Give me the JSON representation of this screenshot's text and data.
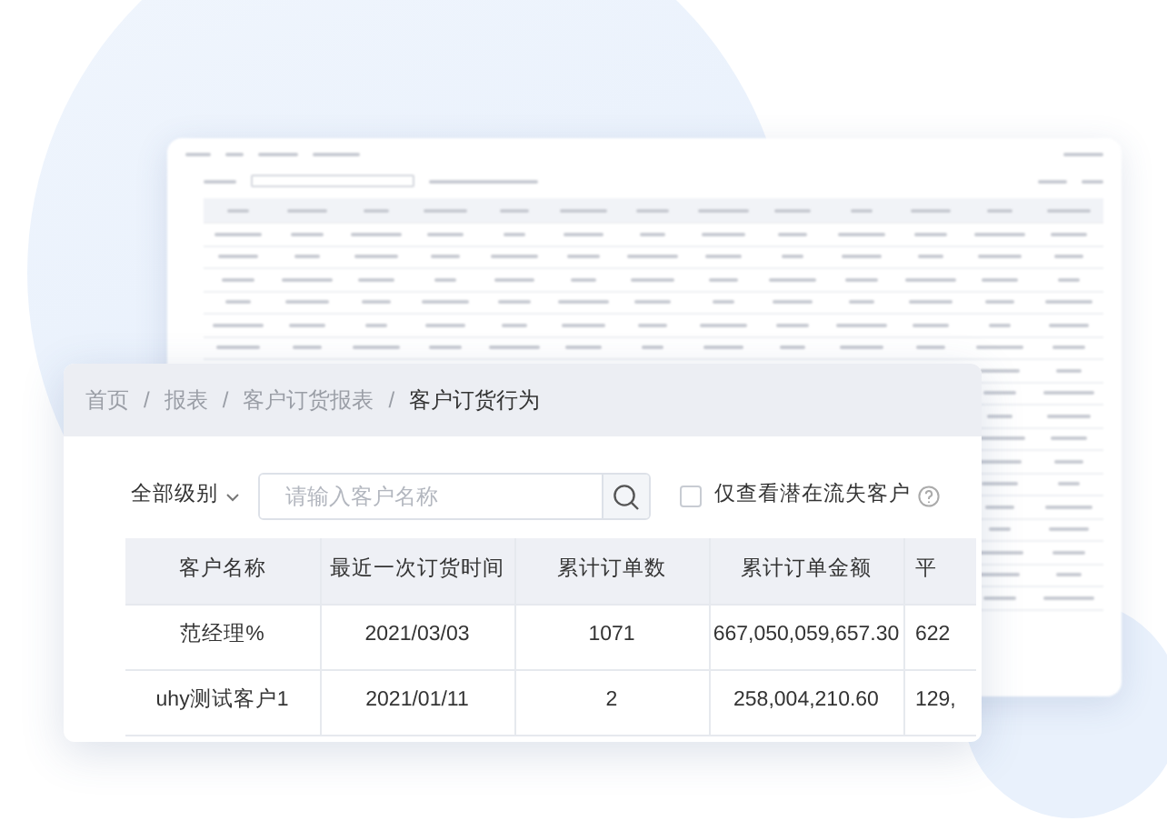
{
  "breadcrumb": {
    "separator": "/",
    "items": [
      {
        "label": "首页",
        "current": false
      },
      {
        "label": "报表",
        "current": false
      },
      {
        "label": "客户订货报表",
        "current": false
      },
      {
        "label": "客户订货行为",
        "current": true
      }
    ]
  },
  "filters": {
    "level_dropdown": "全部级别",
    "search": {
      "placeholder": "请输入客户名称"
    },
    "lost_only": {
      "label": "仅查看潜在流失客户",
      "checked": false
    }
  },
  "table": {
    "columns": [
      "客户名称",
      "最近一次订货时间",
      "累计订单数",
      "累计订单金额",
      "平"
    ],
    "rows": [
      [
        "范经理%",
        "2021/03/03",
        "1071",
        "667,050,059,657.30",
        "622"
      ],
      [
        "uhy测试客户1",
        "2021/01/11",
        "2",
        "258,004,210.60",
        "129,"
      ]
    ]
  }
}
